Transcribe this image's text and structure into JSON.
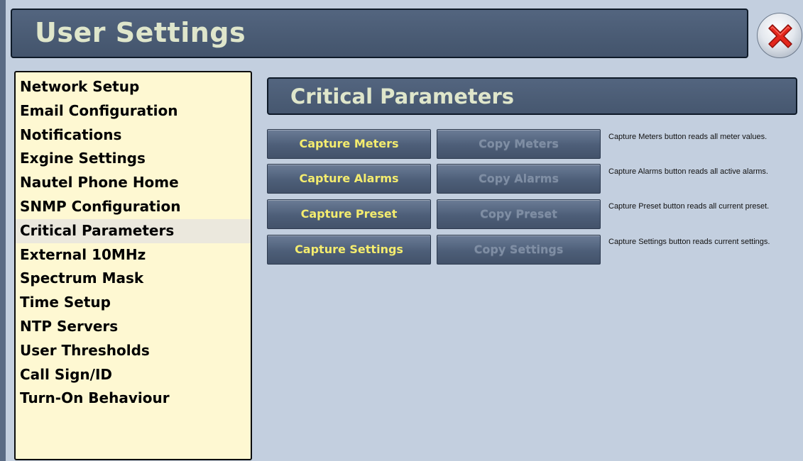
{
  "window": {
    "title": "User Settings"
  },
  "menu": {
    "items": [
      {
        "label": "Network Setup"
      },
      {
        "label": "Email Configuration"
      },
      {
        "label": "Notifications"
      },
      {
        "label": "Exgine Settings"
      },
      {
        "label": "Nautel Phone Home"
      },
      {
        "label": "SNMP Configuration"
      },
      {
        "label": "Critical Parameters"
      },
      {
        "label": "External 10MHz"
      },
      {
        "label": "Spectrum Mask"
      },
      {
        "label": "Time Setup"
      },
      {
        "label": "NTP Servers"
      },
      {
        "label": "User Thresholds"
      },
      {
        "label": "Call Sign/ID"
      },
      {
        "label": "Turn-On Behaviour"
      }
    ],
    "selected": "Critical Parameters"
  },
  "panel": {
    "title": "Critical Parameters",
    "rows": [
      {
        "capture_label": "Capture Meters",
        "copy_label": "Copy Meters",
        "copy_enabled": false,
        "description": "Capture Meters button reads all meter values."
      },
      {
        "capture_label": "Capture Alarms",
        "copy_label": "Copy Alarms",
        "copy_enabled": false,
        "description": "Capture Alarms button reads all active alarms."
      },
      {
        "capture_label": "Capture Preset",
        "copy_label": "Copy Preset",
        "copy_enabled": false,
        "description": "Capture Preset button reads all current preset."
      },
      {
        "capture_label": "Capture Settings",
        "copy_label": "Copy Settings",
        "copy_enabled": false,
        "description": "Capture Settings button reads current settings."
      }
    ]
  },
  "icons": {
    "close": "close-x-icon"
  },
  "colors": {
    "background": "#c3cfdf",
    "header": "#4c5e78",
    "header_text": "#dfe6cb",
    "menu_background": "#fef8d2",
    "menu_selected": "#ebe8dd",
    "capture_text": "#f4ec6e",
    "copy_text_disabled": "#7f8ea4",
    "close_icon": "#e3261c"
  }
}
